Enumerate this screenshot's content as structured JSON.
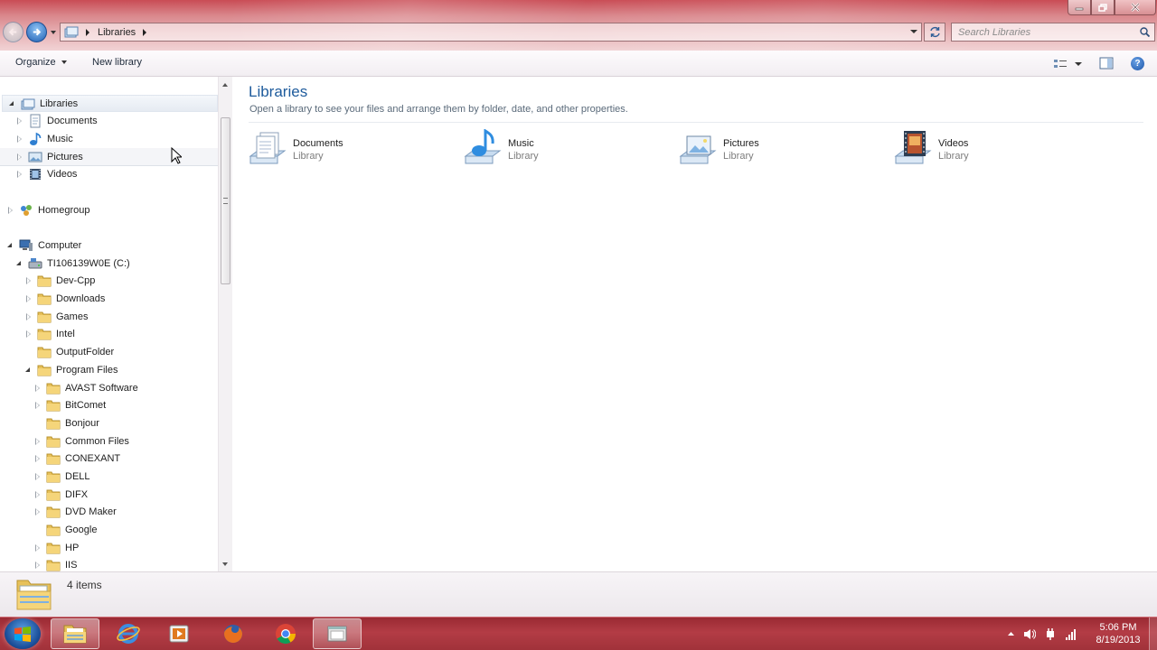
{
  "window": {
    "address_crumb": "Libraries",
    "search_placeholder": "Search Libraries"
  },
  "toolbar": {
    "organize_label": "Organize",
    "new_library_label": "New library",
    "help_label": "?"
  },
  "nav": {
    "libraries": "Libraries",
    "documents": "Documents",
    "music": "Music",
    "pictures": "Pictures",
    "videos": "Videos",
    "homegroup": "Homegroup",
    "computer": "Computer",
    "drive": "TI106139W0E (C:)",
    "folders": [
      "Dev-Cpp",
      "Downloads",
      "Games",
      "Intel",
      "OutputFolder",
      "Program Files"
    ],
    "program_files": [
      "AVAST Software",
      "BitComet",
      "Bonjour",
      "Common Files",
      "CONEXANT",
      "DELL",
      "DIFX",
      "DVD Maker",
      "Google",
      "HP",
      "IIS"
    ]
  },
  "content": {
    "title": "Libraries",
    "subtitle": "Open a library to see your files and arrange them by folder, date, and other properties.",
    "libraries": [
      {
        "name": "Documents",
        "type": "Library"
      },
      {
        "name": "Music",
        "type": "Library"
      },
      {
        "name": "Pictures",
        "type": "Library"
      },
      {
        "name": "Videos",
        "type": "Library"
      }
    ]
  },
  "status": {
    "item_count": "4 items"
  },
  "taskbar": {
    "time": "5:06 PM",
    "date": "8/19/2013",
    "apps": [
      "windows-explorer-icon",
      "internet-explorer-icon",
      "media-player-icon",
      "firefox-icon",
      "chrome-icon",
      "explorer-window-icon"
    ]
  },
  "colors": {
    "accent_title": "#1e5b9c",
    "taskbar": "#a1323a",
    "titlebar": "#d9868b"
  }
}
